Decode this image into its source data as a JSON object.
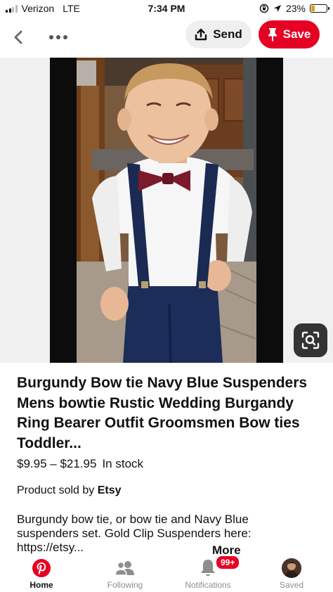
{
  "status_bar": {
    "carrier": "Verizon",
    "network": "LTE",
    "time": "7:34 PM",
    "battery_percent": "23%",
    "battery_level": 0.23
  },
  "top_nav": {
    "send_label": "Send",
    "save_label": "Save"
  },
  "pin": {
    "title": "Burgundy Bow tie Navy Blue Suspenders Mens bowtie Rustic Wedding Burgandy Ring Bearer Outfit Groomsmen Bow ties Toddler...",
    "price": "$9.95 – $21.95",
    "stock": "In stock",
    "sold_by_prefix": "Product sold by",
    "seller": "Etsy",
    "description": "Burgundy bow tie, or bow tie and Navy Blue suspenders set. Gold Clip Suspenders here: https://etsy...",
    "more_label": "More"
  },
  "tab_bar": {
    "tabs": [
      {
        "label": "Home",
        "icon": "pinterest-logo-icon",
        "active": true
      },
      {
        "label": "Following",
        "icon": "people-icon",
        "active": false
      },
      {
        "label": "Notifications",
        "icon": "bell-icon",
        "active": false,
        "badge": "99+"
      },
      {
        "label": "Saved",
        "icon": "avatar",
        "active": false
      }
    ]
  },
  "colors": {
    "brand_red": "#e60023",
    "send_bg": "#efefef",
    "lens_bg": "#333333"
  }
}
